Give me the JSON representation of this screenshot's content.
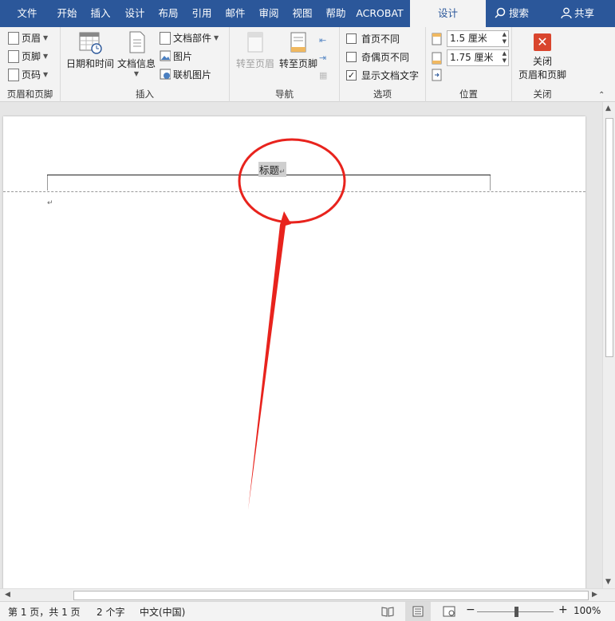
{
  "tabs": [
    "文件",
    "开始",
    "插入",
    "设计",
    "布局",
    "引用",
    "邮件",
    "审阅",
    "视图",
    "帮助",
    "ACROBAT",
    "设计"
  ],
  "search_label": "搜索",
  "share_label": "共享",
  "ribbon": {
    "hf_group": {
      "header_label": "页眉",
      "footer_label": "页脚",
      "page_number_label": "页码",
      "group_label": "页眉和页脚"
    },
    "insert_group": {
      "datetime_label": "日期和时间",
      "docinfo_label": "文档信息",
      "docparts_label": "文档部件",
      "picture_label": "图片",
      "online_picture_label": "联机图片",
      "group_label": "插入"
    },
    "nav_group": {
      "goto_header_label": "转至页眉",
      "goto_footer_label": "转至页脚",
      "group_label": "导航"
    },
    "options_group": {
      "first_page_label": "首页不同",
      "odd_even_label": "奇偶页不同",
      "show_text_label": "显示文档文字",
      "first_page_checked": false,
      "odd_even_checked": false,
      "show_text_checked": true,
      "group_label": "选项"
    },
    "position_group": {
      "header_top_value": "1.5 厘米",
      "footer_bottom_value": "1.75 厘米",
      "group_label": "位置"
    },
    "close_group": {
      "close_label_1": "关闭",
      "close_label_2": "页眉和页脚",
      "group_label": "关闭"
    }
  },
  "document": {
    "header_text": "标题",
    "paragraph_mark": "↵"
  },
  "status": {
    "page": "第 1 页，共 1 页",
    "words": "2 个字",
    "language": "中文(中国)",
    "zoom": "100%"
  },
  "colors": {
    "accent": "#2b579a",
    "annotation": "#e8231d"
  },
  "icons": [
    "search-icon",
    "person-icon",
    "calendar-icon",
    "document-icon",
    "picture-icon",
    "close-icon"
  ]
}
